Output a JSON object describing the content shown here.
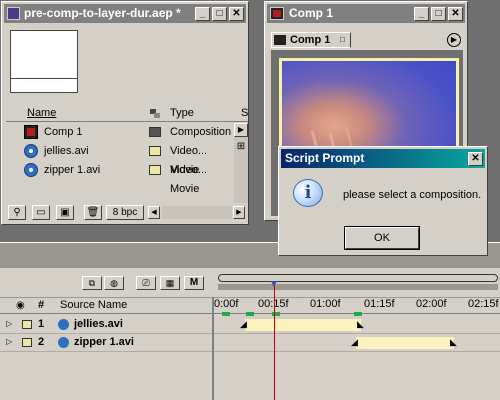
{
  "project": {
    "title": "pre-comp-to-layer-dur.aep *",
    "columns": {
      "name": "Name",
      "type": "Type",
      "extra": "S"
    },
    "items": [
      {
        "name": "Comp 1",
        "type": "Composition",
        "color": "#555555",
        "icon": "composition-icon"
      },
      {
        "name": "jellies.avi",
        "type": "Video... Movie",
        "color": "#efe6a5",
        "icon": "quicktime-icon"
      },
      {
        "name": "zipper 1.avi",
        "type": "Video... Movie",
        "color": "#efe6a5",
        "icon": "quicktime-icon"
      }
    ],
    "bpc_label": "8 bpc"
  },
  "comp_window": {
    "title": "Comp 1",
    "tab_label": "Comp 1"
  },
  "dialog": {
    "title": "Script Prompt",
    "message": "please select a composition.",
    "ok_label": "OK"
  },
  "timeline": {
    "header": {
      "hash": "#",
      "source_name": "Source Name"
    },
    "ruler_labels": [
      "0:00f",
      "00:15f",
      "01:00f",
      "01:15f",
      "02:00f",
      "02:15f"
    ],
    "layers": [
      {
        "number": "1",
        "name": "jellies.avi"
      },
      {
        "number": "2",
        "name": "zipper 1.avi"
      }
    ],
    "mode_label": "M"
  },
  "colors": {
    "active_title_start": "#0a246a",
    "active_title_end": "#0aa8a0",
    "inactive_title": "#808080",
    "panel": "#d4d0c8",
    "layer_bar": "#fbf2be",
    "time_indicator": "#cc0000"
  }
}
